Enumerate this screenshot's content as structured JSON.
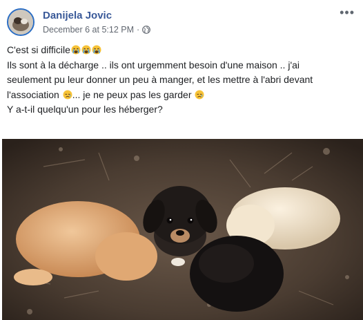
{
  "post": {
    "author": "Danijela Jovic",
    "timestamp": "December 6 at 5:12 PM",
    "separator": "·",
    "privacy_icon": "globe-icon",
    "more_icon": "more-options-icon",
    "text": {
      "line1": "C'est si difficile",
      "line2": "Ils sont à la décharge .. ils ont urgemment besoin d'une maison .. j'ai",
      "line3": "seulement pu leur donner un peu à manger, et les mettre à l'abri devant",
      "line4a": "l'association",
      "line4b": "... je ne peux pas les garder",
      "line5": "Y a-t-il quelqu'un pour les héberger?"
    },
    "emoji_line1": [
      "crying-face-emoji",
      "crying-face-emoji",
      "crying-face-emoji"
    ],
    "emoji_line4": [
      "sad-face-emoji",
      "sad-face-emoji"
    ],
    "photo": "photo of four puppies on dirt ground"
  },
  "colors": {
    "author": "#385898",
    "meta": "#616770",
    "text": "#1c1e21",
    "emoji": "#f7c337"
  }
}
